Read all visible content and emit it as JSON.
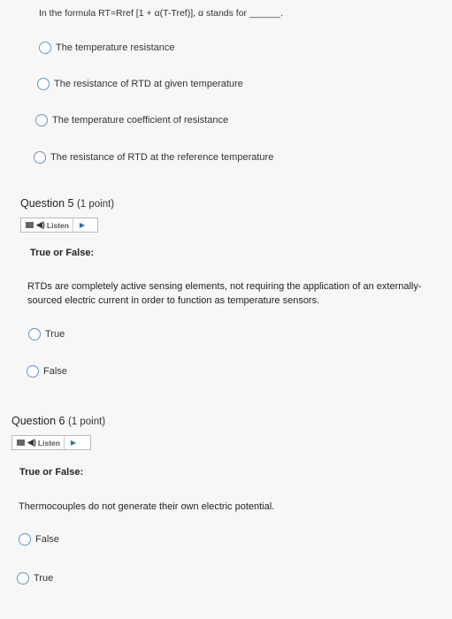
{
  "q4": {
    "prompt": "In the formula RT=Rref [1 + α(T-Tref)], α stands for ______.",
    "options": [
      "The temperature resistance",
      "The resistance of RTD at given temperature",
      "The temperature coefficient of resistance",
      "The resistance of RTD at the reference temperature"
    ]
  },
  "q5": {
    "title": "Question 5",
    "points": "(1 point)",
    "listen_label": "Listen",
    "type_label": "True or False:",
    "statement": "RTDs are completely active sensing elements, not requiring the application of an externally-sourced electric current in order to function as temperature sensors.",
    "options": [
      "True",
      "False"
    ]
  },
  "q6": {
    "title": "Question 6",
    "points": "(1 point)",
    "listen_label": "Listen",
    "type_label": "True or False:",
    "statement": "Thermocouples do not generate their own electric potential.",
    "options": [
      "False",
      "True"
    ]
  },
  "colors": {
    "radio_border": "#6b93c2",
    "play_icon": "#3a6ea5"
  },
  "icons": [
    "speaker-icon",
    "play-icon",
    "toolbar-icon",
    "radio-button"
  ]
}
